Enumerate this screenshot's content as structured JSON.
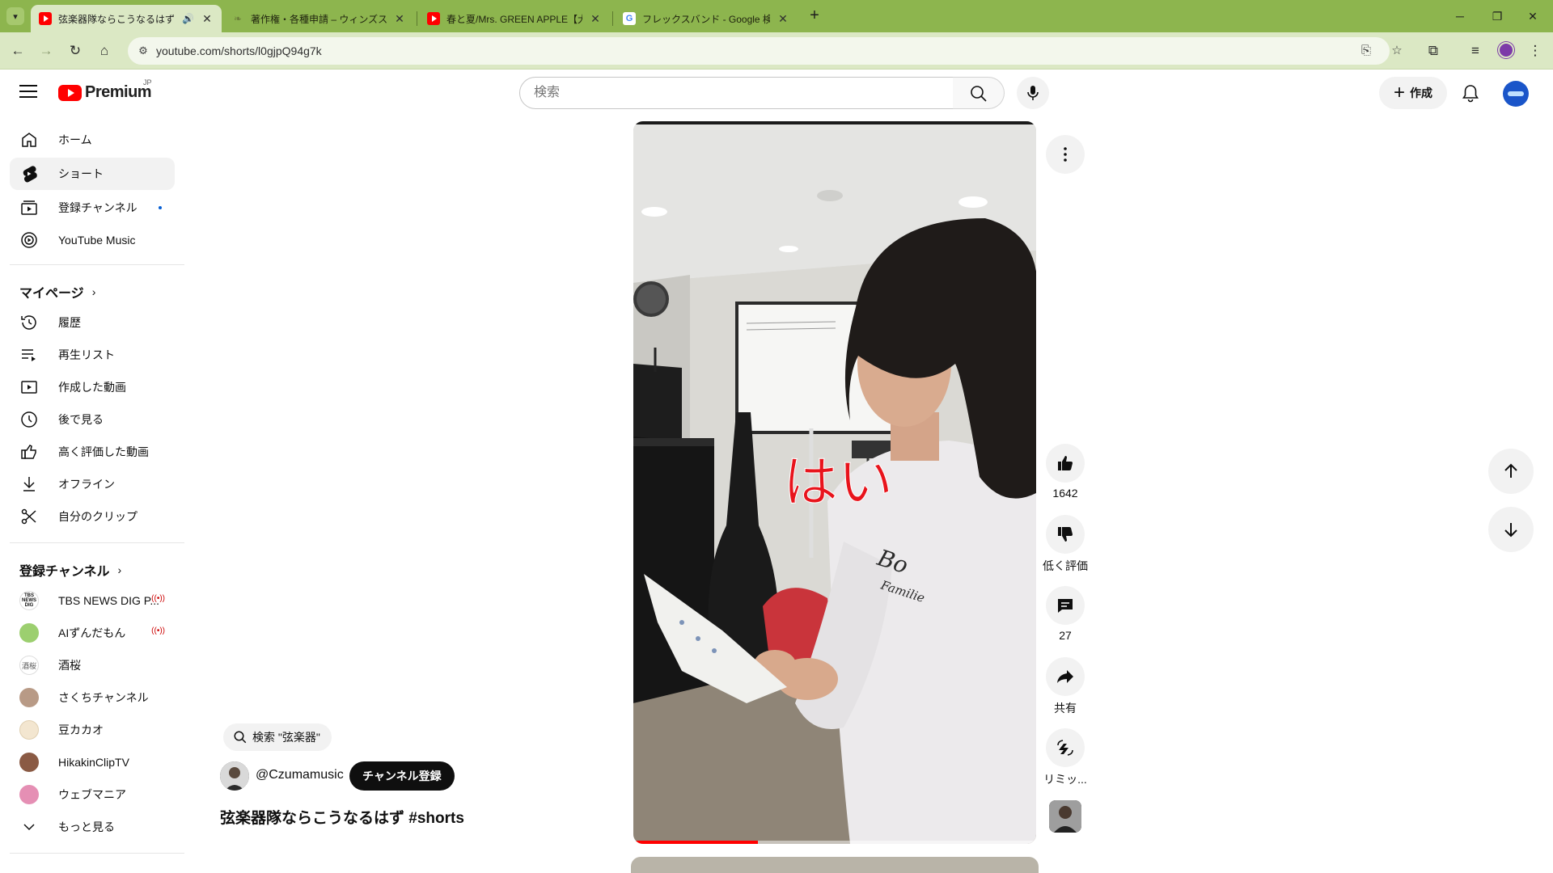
{
  "browser": {
    "tabs": [
      {
        "title": "弦楽器隊ならこうなるはず #sh",
        "favicon": "youtube-icon",
        "active": true
      },
      {
        "title": "著作権・各種申請 – ウィンズスコア",
        "favicon": "leaf-icon",
        "active": false
      },
      {
        "title": "春と夏/Mrs. GREEN APPLE【大阪",
        "favicon": "youtube-icon",
        "active": false
      },
      {
        "title": "フレックスバンド - Google 検索",
        "favicon": "google-icon",
        "active": false
      }
    ],
    "url": "youtube.com/shorts/l0gjpQ94g7k",
    "google_letter": "G",
    "new_tab_glyph": "+"
  },
  "masthead": {
    "logo_text": "Premium",
    "logo_region": "JP",
    "search_placeholder": "検索",
    "create_label": "作成"
  },
  "sidebar": {
    "main_items": [
      {
        "label": "ホーム",
        "icon": "home-icon",
        "active": false
      },
      {
        "label": "ショート",
        "icon": "shorts-icon",
        "active": true
      },
      {
        "label": "登録チャンネル",
        "icon": "subscriptions-icon",
        "active": false,
        "dot": true
      },
      {
        "label": "YouTube Music",
        "icon": "youtube-music-icon",
        "active": false
      }
    ],
    "my_page_heading": "マイページ",
    "my_page_items": [
      {
        "label": "履歴",
        "icon": "history-icon"
      },
      {
        "label": "再生リスト",
        "icon": "playlist-icon"
      },
      {
        "label": "作成した動画",
        "icon": "your-videos-icon"
      },
      {
        "label": "後で見る",
        "icon": "watch-later-icon"
      },
      {
        "label": "高く評価した動画",
        "icon": "thumbs-up-icon"
      },
      {
        "label": "オフライン",
        "icon": "download-icon"
      },
      {
        "label": "自分のクリップ",
        "icon": "scissors-icon"
      }
    ],
    "subscriptions_heading": "登録チャンネル",
    "channels": [
      {
        "name": "TBS NEWS DIG P...",
        "live": true,
        "avatar_color": "#ffffff"
      },
      {
        "name": "AIずんだもん",
        "live": true,
        "avatar_color": "#9ccf6f"
      },
      {
        "name": "酒桜",
        "live": false,
        "avatar_color": "#ffffff"
      },
      {
        "name": "さくちチャンネル",
        "live": false,
        "avatar_color": "#b89a86"
      },
      {
        "name": "豆カカオ",
        "live": false,
        "avatar_color": "#f3e6d0"
      },
      {
        "name": "HikakinClipTV",
        "live": false,
        "avatar_color": "#8a5a44"
      },
      {
        "name": "ウェブマニア",
        "live": false,
        "avatar_color": "#e58fb4"
      }
    ],
    "show_more_label": "もっと見る",
    "tbs_avatar_text": "TBS NEWS DIG",
    "sakezakura_avatar_text": "酒桜"
  },
  "short": {
    "search_chip": "検索 \"弦楽器\"",
    "channel_handle": "@Czumamusic",
    "subscribe_label": "チャンネル登録",
    "title": "弦楽器隊ならこうなるはず #shorts",
    "overlay_caption": "はい",
    "progress_fraction": 0.31,
    "actions": {
      "like_count": "1642",
      "dislike_label": "低く評価",
      "comment_count": "27",
      "share_label": "共有",
      "remix_label": "リミッ..."
    },
    "sweatshirt_text_1": "Bo",
    "sweatshirt_text_2": "Familie"
  },
  "colors": {
    "tabbar": "#8db54e",
    "toolbar": "#dbe8c4",
    "youtube_red": "#ff0000",
    "caption_red": "#e8141c",
    "live_red": "#cc0000",
    "subscribe_bg": "#0f0f0f"
  }
}
